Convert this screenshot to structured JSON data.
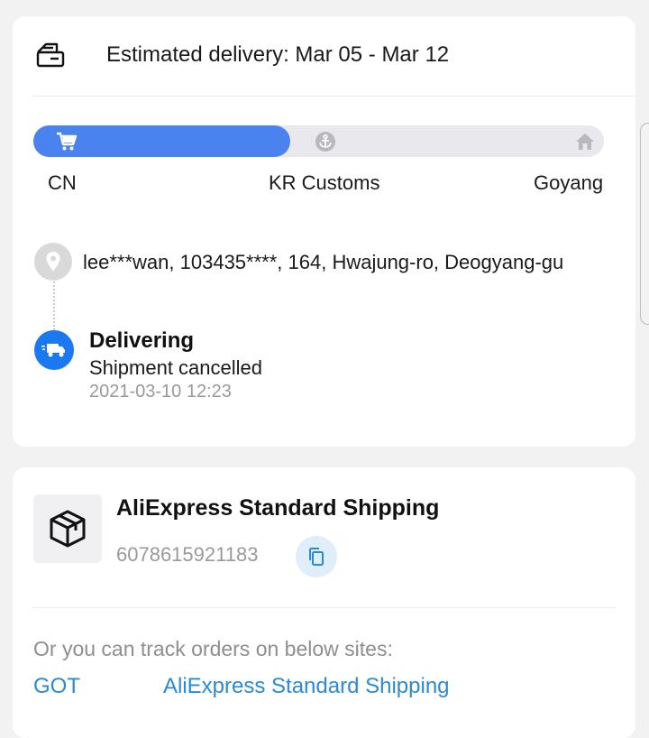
{
  "delivery": {
    "estimated_text": "Estimated delivery: Mar 05 - Mar 12",
    "estimated_icon": "delivery-truck-box-icon",
    "progress": {
      "fill_fraction": 0.45,
      "stops": [
        {
          "label": "CN",
          "icon": "cart-icon"
        },
        {
          "label": "KR Customs",
          "icon": "anchor-icon"
        },
        {
          "label": "Goyang",
          "icon": "home-icon"
        }
      ]
    },
    "address": "lee***wan,  103435****,  164, Hwajung-ro, Deogyang-gu",
    "status": {
      "title": "Delivering",
      "subtitle": "Shipment cancelled",
      "time": "2021-03-10 12:23"
    }
  },
  "shipping": {
    "carrier": "AliExpress Standard Shipping",
    "tracking_number": "6078615921183",
    "hint": "Or you can track orders on below sites:",
    "links": [
      "GOT",
      "AliExpress Standard Shipping"
    ]
  },
  "colors": {
    "accent": "#4a82f0",
    "status_blue": "#1a78f0",
    "link": "#2b8ad6"
  }
}
